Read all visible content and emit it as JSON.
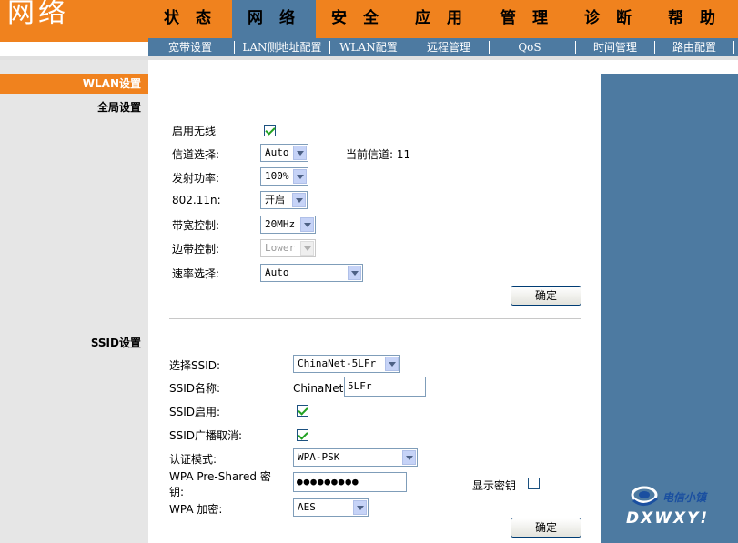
{
  "header": {
    "brand": "网络",
    "nav": [
      {
        "label": "状 态",
        "active": false
      },
      {
        "label": "网 络",
        "active": true
      },
      {
        "label": "安 全",
        "active": false
      },
      {
        "label": "应 用",
        "active": false
      },
      {
        "label": "管 理",
        "active": false
      },
      {
        "label": "诊 断",
        "active": false
      },
      {
        "label": "帮 助",
        "active": false
      }
    ],
    "subnav": [
      "宽带设置",
      "LAN侧地址配置",
      "WLAN配置",
      "远程管理",
      "QoS",
      "时间管理",
      "路由配置"
    ]
  },
  "sidebar": {
    "active_item": "WLAN设置",
    "section_global": "全局设置",
    "section_ssid": "SSID设置"
  },
  "global": {
    "enable_wireless_label": "启用无线",
    "enable_wireless": true,
    "channel_label": "信道选择:",
    "channel_value": "Auto",
    "current_channel_label": "当前信道: 11",
    "power_label": "发射功率:",
    "power_value": "100%",
    "n_label": "802.11n:",
    "n_value": "开启",
    "bandwidth_label": "带宽控制:",
    "bandwidth_value": "20MHz",
    "sideband_label": "边带控制:",
    "sideband_value": "Lower",
    "rate_label": "速率选择:",
    "rate_value": "Auto",
    "confirm_label": "确定"
  },
  "ssid": {
    "select_label": "选择SSID:",
    "select_value": "ChinaNet-5LFr",
    "name_label": "SSID名称:",
    "name_prefix": "ChinaNet-",
    "name_value": "5LFr",
    "enable_label": "SSID启用:",
    "enable": true,
    "broadcast_label": "SSID广播取消:",
    "broadcast_disable": true,
    "auth_label": "认证模式:",
    "auth_value": "WPA-PSK",
    "psk_label_line1": "WPA Pre-Shared 密",
    "psk_label_line2": "钥:",
    "psk_value": "●●●●●●●●●",
    "show_key_label": "显示密钥",
    "show_key": false,
    "encryption_label": "WPA 加密:",
    "encryption_value": "AES",
    "confirm_label": "确定"
  },
  "watermark": {
    "text_top": "电信小镇",
    "text_bottom": "DXWXY!"
  }
}
